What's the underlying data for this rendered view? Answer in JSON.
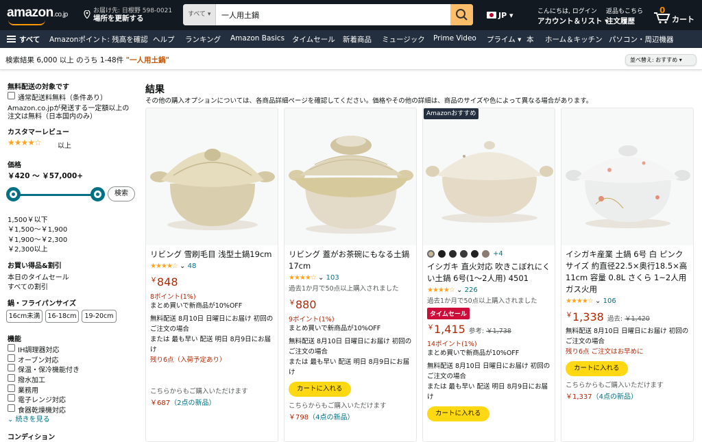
{
  "header": {
    "logo_text": "amazon",
    "logo_suffix": ".co.jp",
    "deliver_line1": "お届け先: 日根野 598-0021",
    "deliver_line2": "場所を更新する",
    "search_category": "すべて",
    "search_value": "一人用土鍋",
    "lang": "JP",
    "account_line1": "こんにちは, ログイン",
    "account_line2": "アカウント＆リスト",
    "returns_line1": "返品もこちら",
    "returns_line2": "注文履歴",
    "cart_count": "0",
    "cart_label": "カート"
  },
  "nav": {
    "menu_label": "すべて",
    "items": [
      "Amazonポイント: 残高を確認",
      "ヘルプ",
      "ランキング",
      "Amazon Basics",
      "タイムセール",
      "新着商品",
      "ミュージック",
      "Prime Video",
      "プライム",
      "本",
      "ホーム＆キッチン",
      "パソコン・周辺機器"
    ]
  },
  "results_bar": {
    "prefix": "検索結果 6,000 以上 のうち 1-48件 ",
    "query": "\"一人用土鍋\"",
    "sort_label": "並べ替え: おすすめ"
  },
  "sidebar": {
    "free_ship_title": "無料配送の対象です",
    "free_ship_option": "通常配送料無料（条件あり）",
    "free_ship_note1": "Amazon.co.jpが発送する一定額以上の",
    "free_ship_note2": "注文は無料（日本国内のみ）",
    "review_title": "カスタマーレビュー",
    "review_stars": "★★★★☆",
    "review_suffix": "以上",
    "price_title": "価格",
    "price_range": "￥420 ～ ￥57,000+",
    "go_label": "検索",
    "price_links": [
      "1,500￥以下",
      "￥1,500～￥1,900",
      "￥1,900～￥2,300",
      "￥2,300以上"
    ],
    "deals_title": "お買い得品&割引",
    "deals": [
      "本日のタイムセール",
      "すべての割引"
    ],
    "size_title": "鍋・フライパンサイズ",
    "sizes": [
      "16cm未満",
      "16-18cm",
      "19-20cm"
    ],
    "function_title": "機能",
    "functions": [
      "IH調理器対応",
      "オーブン対応",
      "保温・保冷機能付き",
      "撥水加工",
      "業務用",
      "電子レンジ対応",
      "食器乾燥機対応"
    ],
    "more_label": "続きを見る",
    "condition_title": "コンディション"
  },
  "main": {
    "title": "結果",
    "subtitle": "その他の購入オプションについては、各商品詳細ページを確認してください。価格やその他の詳細は、商品のサイズや色によって異なる場合があります。",
    "badge": "Amazonおすすめ"
  },
  "products": [
    {
      "title": "リビング 雪刷毛目 浅型土鍋19cm",
      "stars": "★★★★☆",
      "rating_count": "48",
      "price": "848",
      "points": "8ポイント(1%)",
      "discount": "まとめ買いで新商品が10%OFF",
      "delivery1": "無料配送 8月10日 日曜日にお届け 初回のご注文の場合",
      "delivery2": "または 最も早い 配送 明日 8月9日にお届け",
      "stock": "残り6点（入荷予定あり）",
      "other_buy": "こちらからもご購入いただけます",
      "alt_price": "￥687",
      "alt_offers": "（2点の新品）"
    },
    {
      "title": "リビング 蓋がお茶碗にもなる土鍋 17cm",
      "stars": "★★★★☆",
      "rating_count": "103",
      "bought": "過去1か月で50点以上購入されました",
      "price": "880",
      "points": "9ポイント(1%)",
      "discount": "まとめ買いで新商品が10%OFF",
      "delivery1": "無料配送 8月10日 日曜日にお届け 初回のご注文の場合",
      "delivery2": "または 最も早い 配送 明日 8月9日にお届け",
      "add_to_cart": "カートに入れる",
      "other_buy": "こちらからもご購入いただけます",
      "alt_price": "￥798",
      "alt_offers": "（4点の新品）"
    },
    {
      "swatch_colors": [
        "#c9b79a",
        "#1f1f1f",
        "#2b2b2b",
        "#3a3a3a",
        "#222222",
        "#8c7b70"
      ],
      "more_colors": "+4",
      "title": "イシガキ 直火対応 吹きこぼれにくい土鍋 6号(1〜2人用) 4501",
      "stars": "★★★★☆",
      "rating_count": "226",
      "bought": "過去1か月で50点以上購入されました",
      "deal": "タイムセール",
      "price": "1,415",
      "ref_label": "参考:",
      "ref_price": "￥1,738",
      "points": "14ポイント(1%)",
      "discount": "まとめ買いで新商品が10%OFF",
      "delivery1": "無料配送 8月10日 日曜日にお届け 初回のご注文の場合",
      "delivery2": "または 最も早い 配送 明日 8月9日にお届け",
      "add_to_cart": "カートに入れる"
    },
    {
      "title": "イシガキ産業 土鍋 6号 白 ピンク サイズ 約直径22.5×奥行18.5×高11cm 容量 0.8L さくら 1~2人用 ガス火用",
      "stars": "★★★★☆",
      "rating_count": "106",
      "price": "1,338",
      "ref_label": "過去:",
      "ref_price": "￥1,420",
      "delivery1": "無料配送 8月10日 日曜日にお届け 初回のご注文の場合",
      "stock": "残り6点 ご注文はお早めに",
      "add_to_cart": "カートに入れる",
      "other_buy": "こちらからもご購入いただけます",
      "alt_price": "￥1,337",
      "alt_offers": "（4点の新品）"
    }
  ],
  "colors": {
    "nav_dark": "#131921",
    "nav_secondary": "#232f3e",
    "search_button": "#febd69",
    "cart_button": "#ffd814",
    "price_red": "#b12704",
    "link_teal": "#007185",
    "star_orange": "#ffa41c"
  }
}
